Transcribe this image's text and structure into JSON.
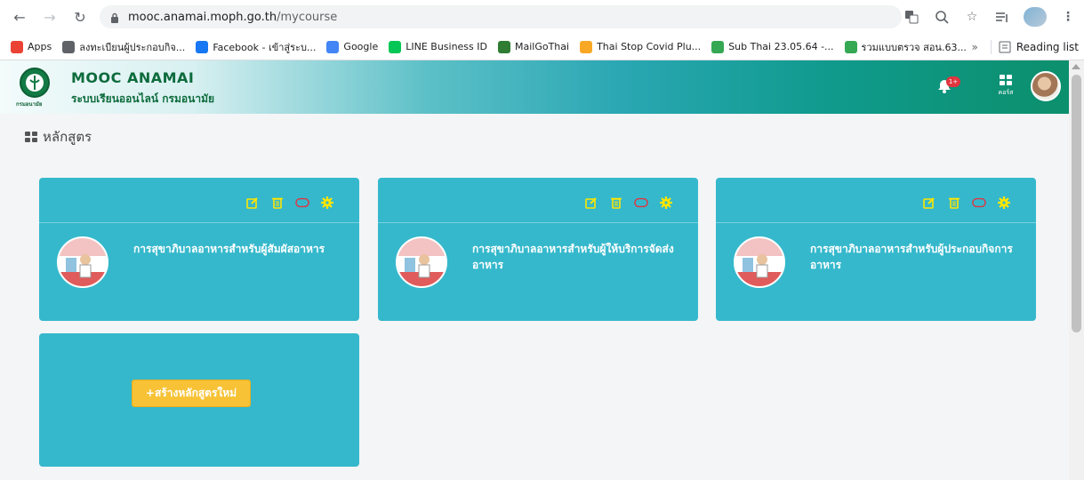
{
  "browser": {
    "url_host": "mooc.anamai.moph.go.th",
    "url_path": "/mycourse",
    "bookmarks": [
      {
        "label": "Apps",
        "color": "#ea4335"
      },
      {
        "label": "ลงทะเบียนผู้ประกอบกิจ...",
        "color": "#5f6368"
      },
      {
        "label": "Facebook - เข้าสู่ระบ...",
        "color": "#1877f2"
      },
      {
        "label": "Google",
        "color": "#4285f4"
      },
      {
        "label": "LINE Business ID",
        "color": "#06c755"
      },
      {
        "label": "MailGoThai",
        "color": "#2e7d32"
      },
      {
        "label": "Thai Stop Covid Plu...",
        "color": "#f9a825"
      },
      {
        "label": "Sub Thai 23.05.64 -...",
        "color": "#34a853"
      },
      {
        "label": "รวมแบบตรวจ สอน.63...",
        "color": "#34a853"
      }
    ],
    "more": "»",
    "reading_list": "Reading list"
  },
  "app": {
    "brand_title": "MOOC ANAMAI",
    "brand_sub": "ระบบเรียนออนไลน์ กรมอนามัย",
    "logo_sub": "กรมอนามัย",
    "notif_badge": "1+",
    "course_nav_label": "คอร์ส"
  },
  "page": {
    "title": "หลักสูตร"
  },
  "courses": [
    {
      "title": "การสุขาภิบาลอาหารสำหรับผู้สัมผัสอาหาร"
    },
    {
      "title": "การสุขาภิบาลอาหารสำหรับผู้ให้บริการจัดส่งอาหาร"
    },
    {
      "title": "การสุขาภิบาลอาหารสำหรับผู้ประกอบกิจการอาหาร"
    }
  ],
  "new_course_button": "+สร้างหลักสูตรใหม่",
  "colors": {
    "card": "#35b8cc",
    "tool_icon": "#ffe600",
    "disable_icon": "#e0343f",
    "new_button": "#f7c235",
    "header_end": "#0c8f6c"
  }
}
